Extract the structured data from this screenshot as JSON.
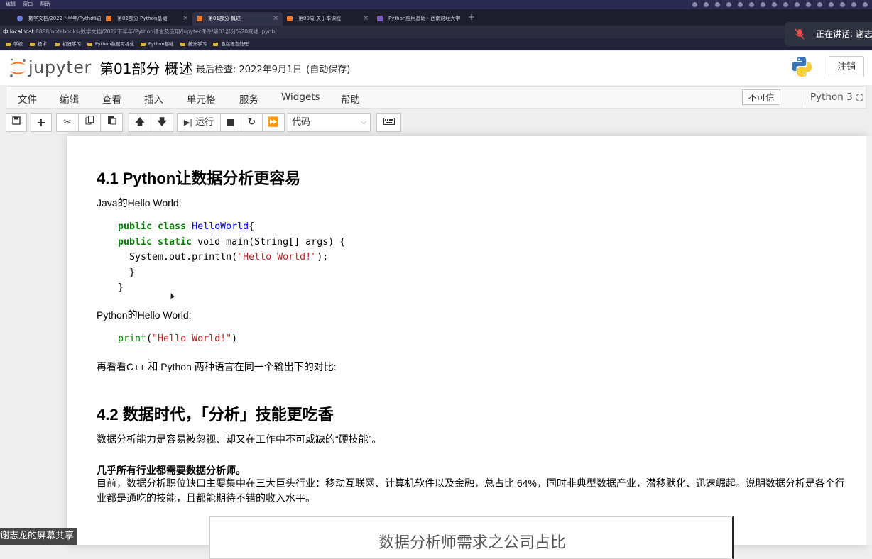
{
  "mac_menu": {
    "items": [
      "编辑",
      "窗口",
      "帮助"
    ]
  },
  "browser": {
    "tabs": [
      {
        "title": "数学文档/2022下半年/Python语..."
      },
      {
        "title": "第02部分 Python基础"
      },
      {
        "title": "第01部分 概述"
      },
      {
        "title": "第00周 关于本课程"
      },
      {
        "title": "Python应用基础 - 西南财经大学"
      }
    ],
    "new_tab": "+",
    "url_host": "localhost",
    "url_path": ":8888/notebooks/数学文档/2022下半年/Python语言及应用/Jupyter课件/第01部分%20概述.ipynb",
    "bookmarks": [
      "学校",
      "技术",
      "机器学习",
      "Python数据可视化",
      "Python基础",
      "统计学习",
      "自然语言处理"
    ],
    "left_stub": "中"
  },
  "speaking": {
    "label": "正在讲话: 谢志"
  },
  "jupyter": {
    "logo_text": "jupyter",
    "notebook_title": "第01部分 概述",
    "checkpoint_label": "最后检查: 2022年9月1日",
    "autosave": "(自动保存)",
    "logout": "注销",
    "menu": [
      "文件",
      "编辑",
      "查看",
      "插入",
      "单元格",
      "服务",
      "Widgets",
      "帮助"
    ],
    "trust": "不可信",
    "kernel": "Python 3",
    "run_label": "运行",
    "cell_type": "代码"
  },
  "cell": {
    "h41": "4.1 Python让数据分析更容易",
    "java_intro": "Java的Hello World:",
    "java_code": {
      "l1_kw": "public class ",
      "l1_cls": "HelloWorld",
      "l1_rest": "{",
      "l2_kw": "public static ",
      "l2_rest": "void main(String[] args) {",
      "l3_pre": "  System.out.println(",
      "l3_str": "\"Hello World!\"",
      "l3_post": ");",
      "l4": "  }",
      "l5": "}"
    },
    "py_intro": "Python的Hello World:",
    "py_code": {
      "fn": "print",
      "open": "(",
      "str": "\"Hello World!\"",
      "close": ")"
    },
    "compare": "再看看C++ 和 Python 两种语言在同一个输出下的对比:",
    "h42": "4.2 数据时代，「分析」技能更吃香",
    "p1": "数据分析能力是容易被忽视、却又在工作中不可或缺的“硬技能”。",
    "bold_line": "几乎所有行业都需要数据分析师。",
    "p2": "目前，数据分析职位缺口主要集中在三大巨头行业：移动互联网、计算机软件以及金融，总占比 64%，同时非典型数据产业，潜移默化、迅速崛起。说明数据分析是各个行业都是通吃的技能，且都能期待不错的收入水平。",
    "chart_title": "数据分析师需求之公司占比"
  },
  "screen_share": {
    "label": "谢志龙的屏幕共享"
  }
}
